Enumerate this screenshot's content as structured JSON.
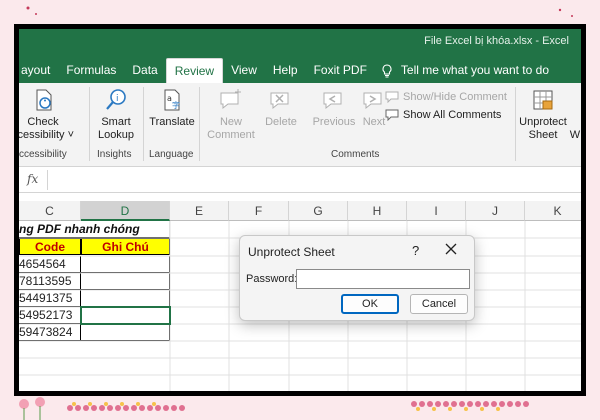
{
  "window": {
    "title": "File Excel bị khóa.xlsx  -  Excel"
  },
  "tabs": [
    {
      "label": "ayout",
      "active": false
    },
    {
      "label": "Formulas",
      "active": false
    },
    {
      "label": "Data",
      "active": false
    },
    {
      "label": "Review",
      "active": true
    },
    {
      "label": "View",
      "active": false
    },
    {
      "label": "Help",
      "active": false
    },
    {
      "label": "Foxit PDF",
      "active": false
    }
  ],
  "tell_me": "Tell me what you want to do",
  "ribbon": {
    "check_label1": "Check",
    "check_label2": "ccessibility ˅",
    "accessibility_group": "ccessibility",
    "smart_label1": "Smart",
    "smart_label2": "Lookup",
    "insights_group": "Insights",
    "translate_label": "Translate",
    "language_group": "Language",
    "new_comment1": "New",
    "new_comment2": "Comment",
    "delete_label": "Delete",
    "previous_label": "Previous",
    "next_label": "Next",
    "show_hide": "Show/Hide Comment",
    "show_all": "Show All Comments",
    "comments_group": "Comments",
    "unprotect1": "Unprotect",
    "unprotect2": "Sheet",
    "w_partial": "W"
  },
  "formula_bar": {
    "fx": "fx"
  },
  "columns": [
    "C",
    "D",
    "E",
    "F",
    "G",
    "H",
    "I",
    "J",
    "K"
  ],
  "sheet": {
    "title_text": "ng PDF nhanh chóng",
    "header_code": "Code",
    "header_note": "Ghi Chú",
    "codes": [
      "4654564",
      "78113595",
      "54491375",
      "54952173",
      "59473824"
    ]
  },
  "dialog": {
    "title": "Unprotect Sheet",
    "help": "?",
    "password_label": "Password:",
    "password_value": "",
    "ok": "OK",
    "cancel": "Cancel"
  },
  "colors": {
    "excel_green": "#217346",
    "header_yellow": "#ffff00",
    "header_text": "#c00000",
    "background": "#fbe9ec"
  }
}
